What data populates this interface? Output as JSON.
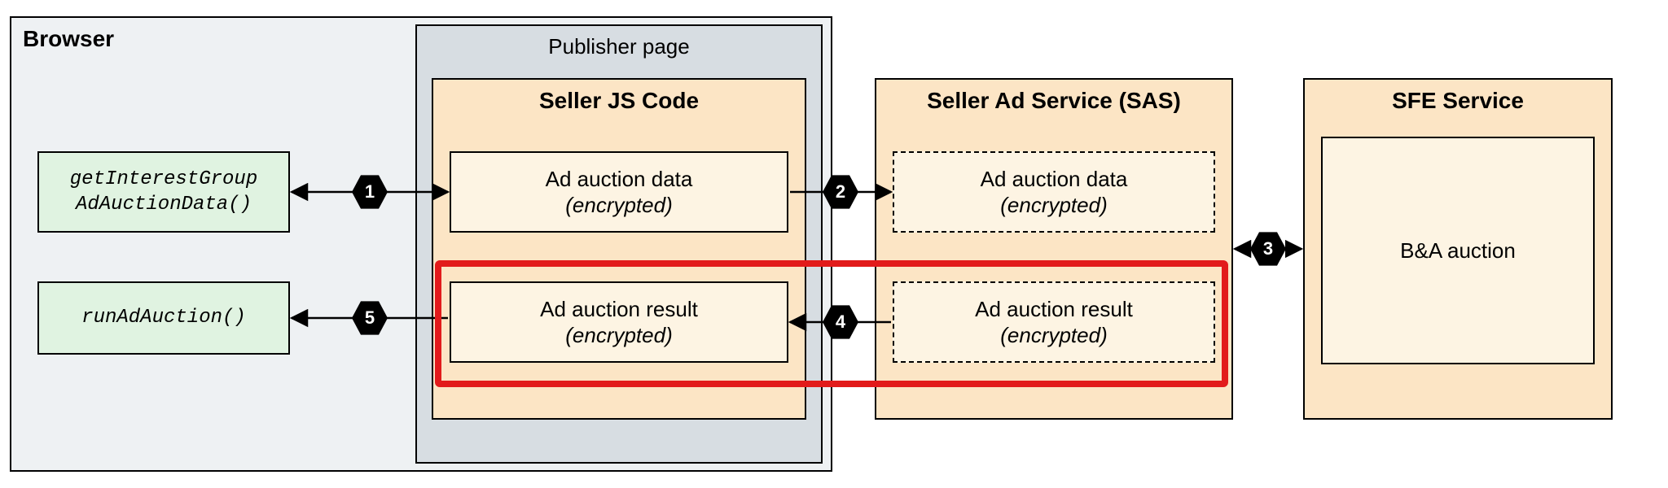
{
  "browser": {
    "title": "Browser"
  },
  "publisher": {
    "title": "Publisher page"
  },
  "seller_js": {
    "title": "Seller JS Code"
  },
  "sas": {
    "title": "Seller Ad Service (SAS)"
  },
  "sfe": {
    "title": "SFE Service"
  },
  "api1_line1": "getInterestGroup",
  "api1_line2": "AdAuctionData()",
  "api2": "runAdAuction()",
  "ad_data_line1": "Ad auction data",
  "ad_data_line2": "(encrypted)",
  "ad_result_line1": "Ad auction result",
  "ad_result_line2": "(encrypted)",
  "ba_auction": "B&A auction",
  "steps": {
    "s1": "1",
    "s2": "2",
    "s3": "3",
    "s4": "4",
    "s5": "5"
  }
}
